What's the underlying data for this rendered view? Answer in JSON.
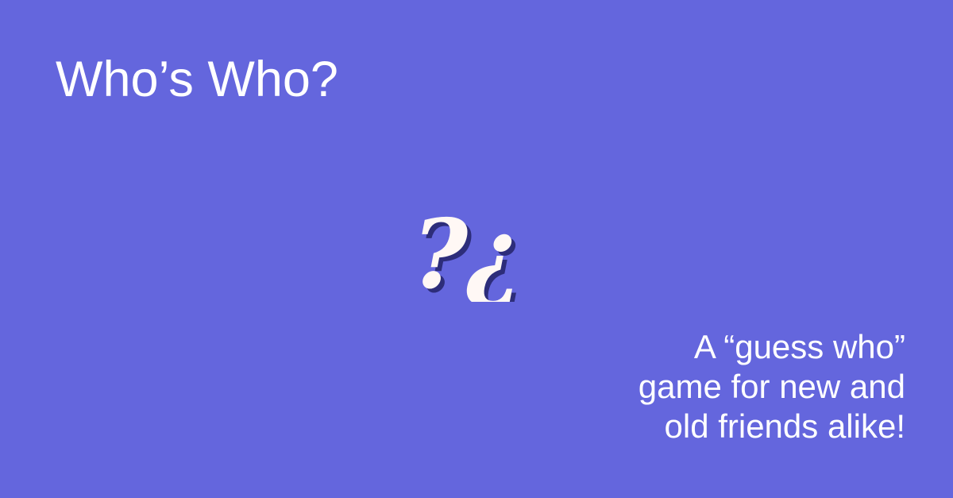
{
  "title": "Who’s Who?",
  "logo": {
    "icon": "question-and-inverted-question-mark-logo",
    "glyph_left": "?",
    "glyph_right": "¿",
    "fill_color": "#FFF8F5",
    "shadow_color": "#2D2D7A"
  },
  "tagline": {
    "lines": [
      "A “guess who”",
      "game for new and",
      "old friends alike!"
    ]
  },
  "colors": {
    "background": "#6466DD",
    "text": "#FFFFFF"
  }
}
